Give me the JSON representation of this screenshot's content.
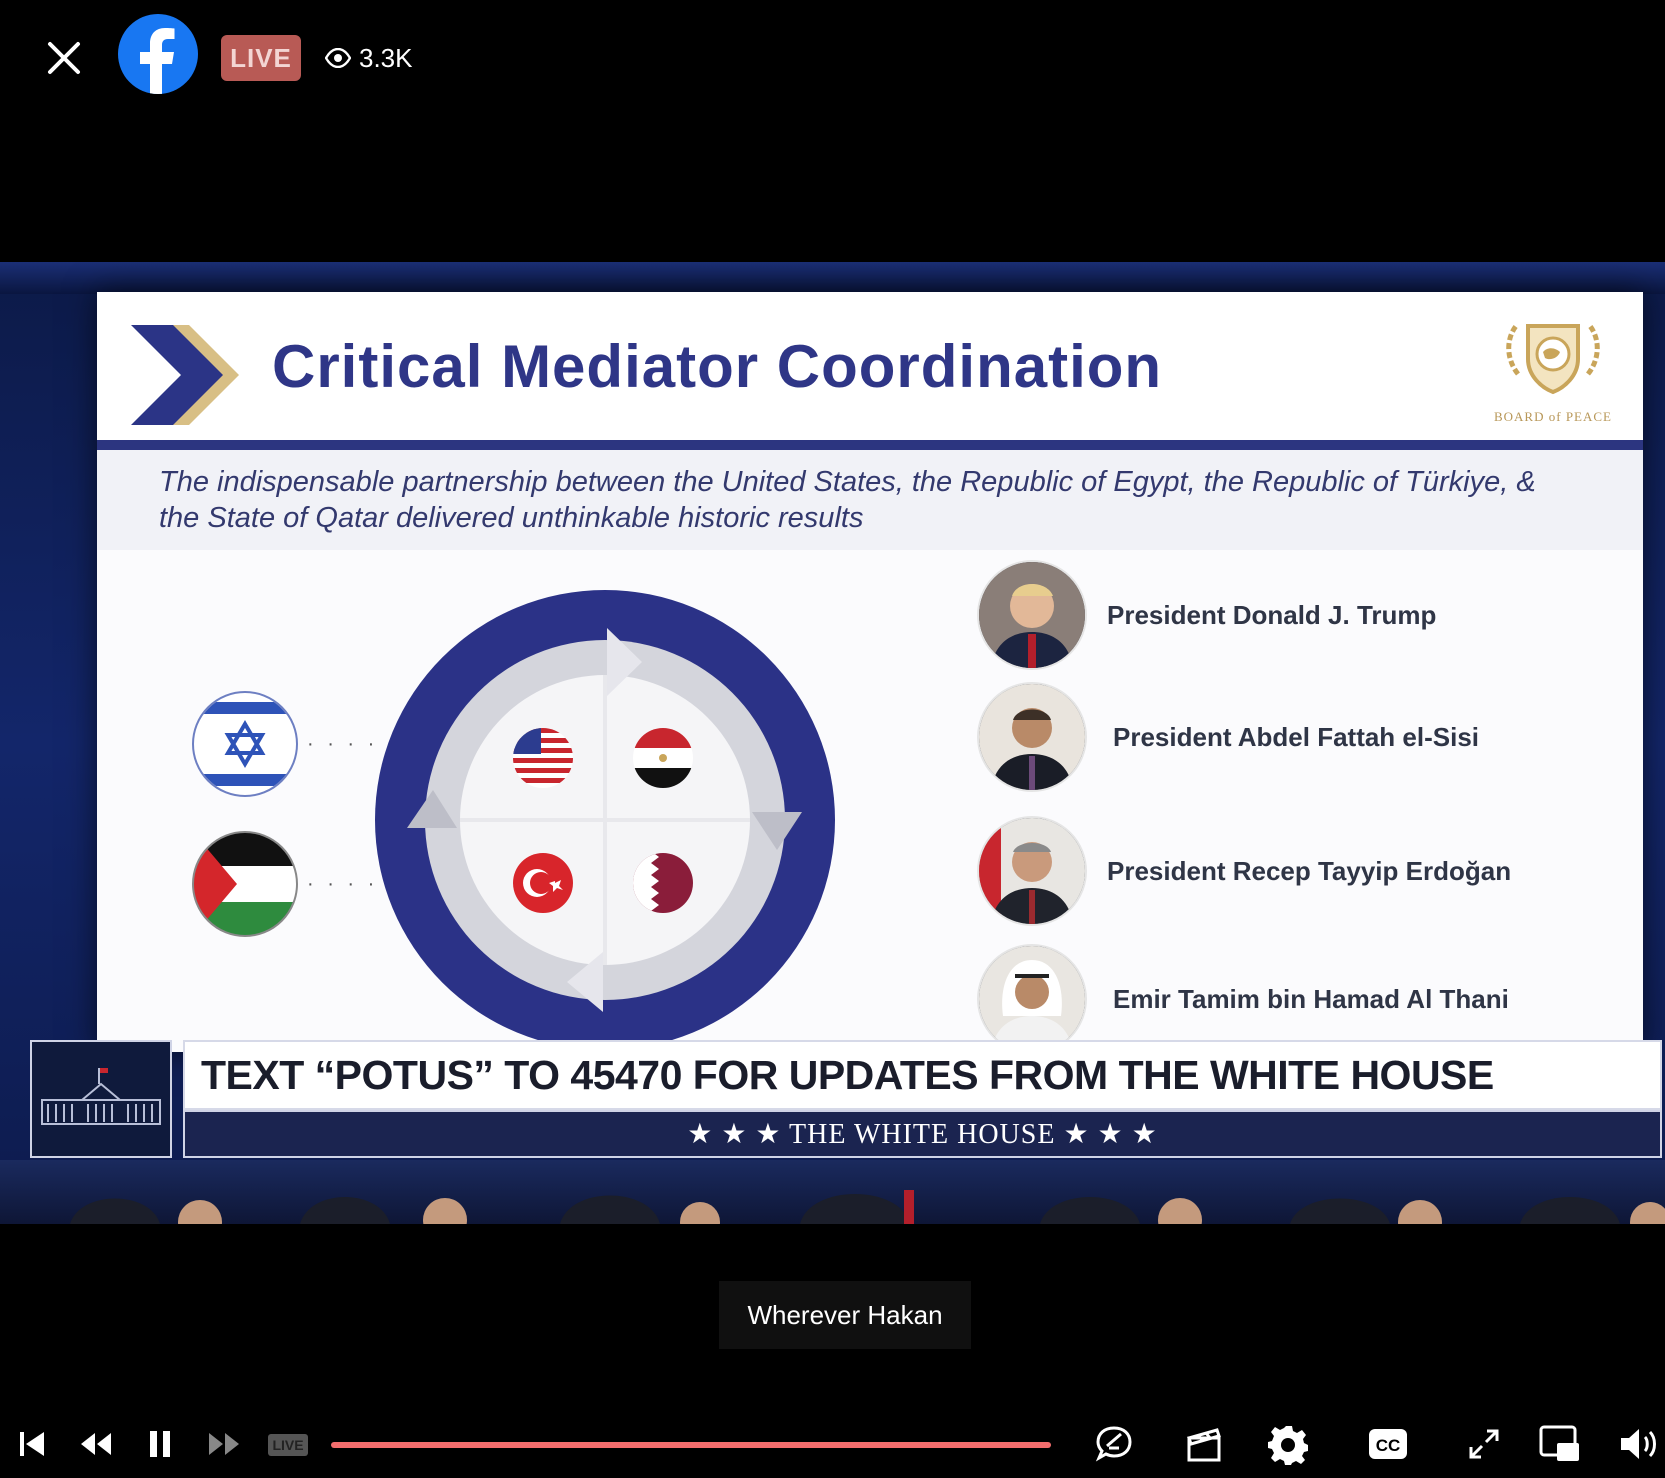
{
  "header": {
    "close_icon": "close-icon",
    "app_logo": "facebook-logo",
    "live_label": "LIVE",
    "viewer_count": "3.3K"
  },
  "slide": {
    "title": "Critical Mediator Coordination",
    "subtitle": "The indispensable partnership between the United States, the Republic of Egypt, the Republic of Türkiye, & the State of Qatar delivered unthinkable historic results",
    "seal_text": "BOARD of PEACE",
    "flags": [
      "israel-flag",
      "palestine-flag",
      "usa-flag",
      "egypt-flag",
      "turkey-flag",
      "qatar-flag"
    ],
    "leaders": [
      {
        "name": "President Donald J. Trump"
      },
      {
        "name": "President Abdel Fattah el-Sisi"
      },
      {
        "name": "President Recep Tayyip Erdoğan"
      },
      {
        "name": "Emir Tamim bin Hamad Al Thani"
      }
    ],
    "colors": {
      "navy": "#2f3687",
      "gold": "#c9a55a"
    }
  },
  "lower_third": {
    "headline": "TEXT “POTUS” TO 45470 FOR UPDATES FROM THE WHITE HOUSE",
    "brand": "★ ★ ★   THE WHITE HOUSE   ★ ★ ★"
  },
  "caption": "Wherever Hakan",
  "controls": {
    "live_label": "LIVE",
    "progress": 1.0,
    "accent": "#f26d6d",
    "icons": [
      "skip-back-icon",
      "rewind-icon",
      "pause-icon",
      "fast-forward-icon",
      "comments-icon",
      "clips-icon",
      "settings-icon",
      "captions-icon",
      "fullscreen-icon",
      "pip-icon",
      "volume-icon"
    ]
  }
}
